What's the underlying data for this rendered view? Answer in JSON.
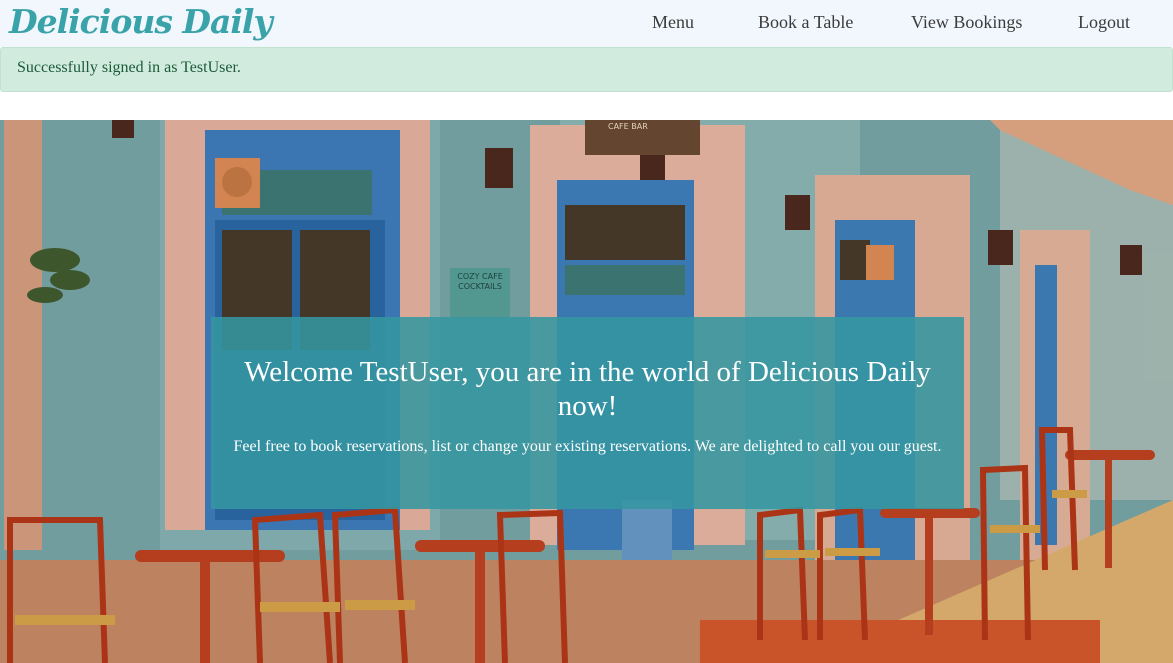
{
  "navbar": {
    "brand": "Delicious Daily",
    "links": [
      {
        "label": "Menu"
      },
      {
        "label": "Book a Table"
      },
      {
        "label": "View Bookings"
      },
      {
        "label": "Logout"
      }
    ]
  },
  "alert": {
    "message": "Successfully signed in as TestUser."
  },
  "hero": {
    "title": "Welcome TestUser, you are in the world of Delicious Daily now!",
    "subtitle": "Feel free to book reservations, list or change your existing reservations. We are delighted to call you our guest.",
    "sign_text": "COZY CAFE COCKTAILS",
    "bar_sign": "CAFE BAR",
    "colors": {
      "brand": "#3aa3aa",
      "card": "#3496a0",
      "alert_bg": "#d1ecdf",
      "navbar_bg": "#f1f7fd"
    }
  }
}
